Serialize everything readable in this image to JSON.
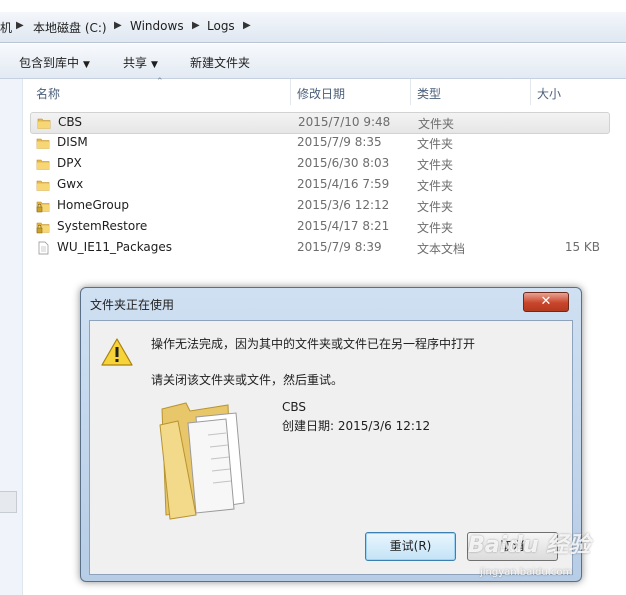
{
  "breadcrumb": {
    "items": [
      "机",
      "本地磁盘 (C:)",
      "Windows",
      "Logs"
    ]
  },
  "toolbar": {
    "include_library": "包含到库中",
    "share": "共享",
    "new_folder": "新建文件夹"
  },
  "columns": {
    "name": "名称",
    "date_modified": "修改日期",
    "type": "类型",
    "size": "大小"
  },
  "files": [
    {
      "name": "CBS",
      "date": "2015/7/10 9:48",
      "type": "文件夹",
      "size": "",
      "icon": "folder-icon"
    },
    {
      "name": "DISM",
      "date": "2015/7/9 8:35",
      "type": "文件夹",
      "size": "",
      "icon": "folder-icon"
    },
    {
      "name": "DPX",
      "date": "2015/6/30 8:03",
      "type": "文件夹",
      "size": "",
      "icon": "folder-icon"
    },
    {
      "name": "Gwx",
      "date": "2015/4/16 7:59",
      "type": "文件夹",
      "size": "",
      "icon": "folder-icon"
    },
    {
      "name": "HomeGroup",
      "date": "2015/3/6 12:12",
      "type": "文件夹",
      "size": "",
      "icon": "locked-folder-icon"
    },
    {
      "name": "SystemRestore",
      "date": "2015/4/17 8:21",
      "type": "文件夹",
      "size": "",
      "icon": "locked-folder-icon"
    },
    {
      "name": "WU_IE11_Packages",
      "date": "2015/7/9 8:39",
      "type": "文本文档",
      "size": "15 KB",
      "icon": "text-document-icon"
    }
  ],
  "dialog": {
    "title": "文件夹正在使用",
    "close_label": "✕",
    "message": "操作无法完成，因为其中的文件夹或文件已在另一程序中打开",
    "instruction": "请关闭该文件夹或文件，然后重试。",
    "file_name": "CBS",
    "created": "创建日期: 2015/3/6 12:12",
    "retry_label": "重试(R)",
    "cancel_label": "取消"
  },
  "watermark": {
    "text": "Baidu 经验",
    "url": "jingyan.baidu.com"
  },
  "colors": {
    "selection": "#e6e6e6",
    "dialog_frame": "#b7cde6",
    "folder": "#f2c94c"
  }
}
